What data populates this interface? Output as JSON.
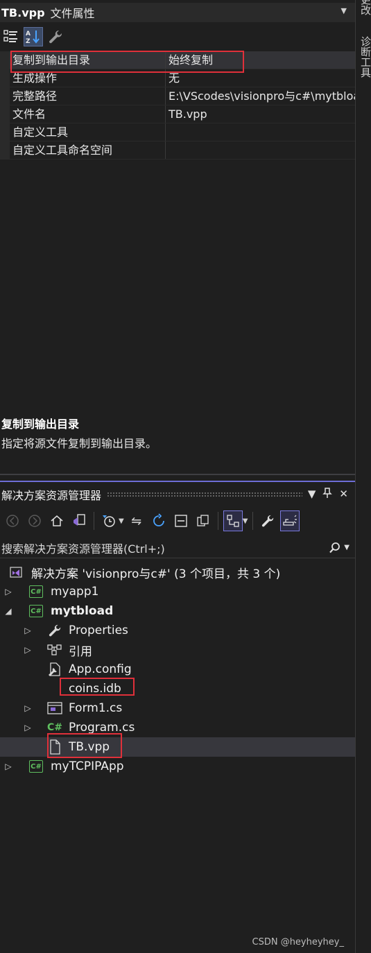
{
  "right_strip": {
    "tab_a": "更改",
    "tab_b": "诊断工具"
  },
  "properties": {
    "file_name": "TB.vpp",
    "kind": "文件属性",
    "rows": [
      {
        "key": "复制到输出目录",
        "value": "始终复制"
      },
      {
        "key": "生成操作",
        "value": "无"
      },
      {
        "key": "完整路径",
        "value": "E:\\VScodes\\visionpro与c#\\mytbload\\TB.vpp"
      },
      {
        "key": "文件名",
        "value": "TB.vpp"
      },
      {
        "key": "自定义工具",
        "value": ""
      },
      {
        "key": "自定义工具命名空间",
        "value": ""
      }
    ],
    "description": {
      "title": "复制到输出目录",
      "text": "指定将源文件复制到输出目录。"
    }
  },
  "solution_explorer": {
    "title": "解决方案资源管理器",
    "search_placeholder": "搜索解决方案资源管理器(Ctrl+;)",
    "cs_badge": "C#",
    "tree": [
      {
        "label": "解决方案 'visionpro与c#' (3 个项目，共 3 个)"
      },
      {
        "label": "myapp1"
      },
      {
        "label": "mytbload"
      },
      {
        "label": "Properties"
      },
      {
        "label": "引用"
      },
      {
        "label": "App.config"
      },
      {
        "label": "coins.idb"
      },
      {
        "label": "Form1.cs"
      },
      {
        "label": "Program.cs"
      },
      {
        "label": "TB.vpp"
      },
      {
        "label": "myTCPIPApp"
      }
    ]
  },
  "watermark": "CSDN @heyheyhey_",
  "colors": {
    "accent": "#6e6ed6",
    "highlight_box": "#e0303a",
    "csharp_green": "#5fbf5f"
  }
}
